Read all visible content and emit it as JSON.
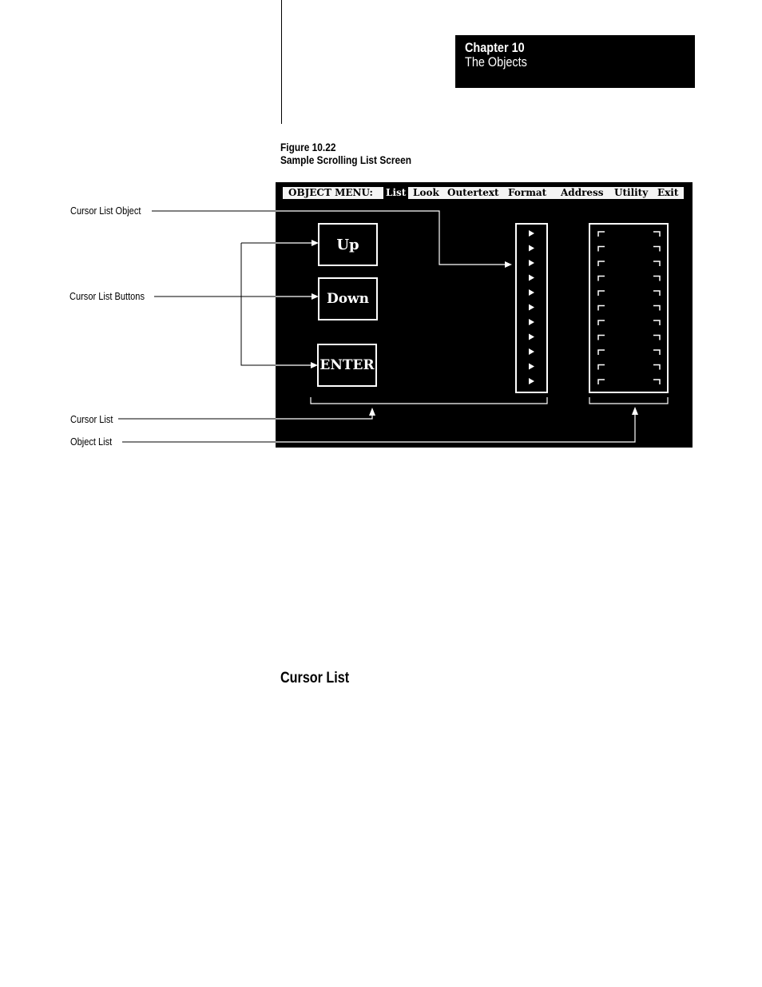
{
  "header": {
    "chapter_label": "Chapter  10",
    "chapter_title": "The Objects"
  },
  "figure": {
    "number": "Figure 10.22",
    "title": "Sample Scrolling List Screen"
  },
  "screen": {
    "menu": {
      "label": "OBJECT MENU:",
      "items": [
        {
          "label": "List",
          "selected": true
        },
        {
          "label": "Look",
          "selected": false
        },
        {
          "label": "Outertext",
          "selected": false
        },
        {
          "label": "Format",
          "selected": false
        },
        {
          "label": "Address",
          "selected": false
        },
        {
          "label": "Utility",
          "selected": false
        },
        {
          "label": "Exit",
          "selected": false
        }
      ]
    },
    "buttons": [
      {
        "label": "Up"
      },
      {
        "label": "Down"
      },
      {
        "label": "ENTER"
      }
    ],
    "cursor_list": {
      "rows": 11,
      "marker_icon": "triangle-right-icon"
    },
    "object_list": {
      "rows": 11,
      "marker_icon": "corner-bracket-icon"
    }
  },
  "callouts": {
    "cursor_list_object": "Cursor List Object",
    "cursor_list_buttons": "Cursor List Buttons",
    "cursor_list": "Cursor List",
    "object_list": "Object List"
  },
  "section": {
    "heading": "Cursor List"
  }
}
